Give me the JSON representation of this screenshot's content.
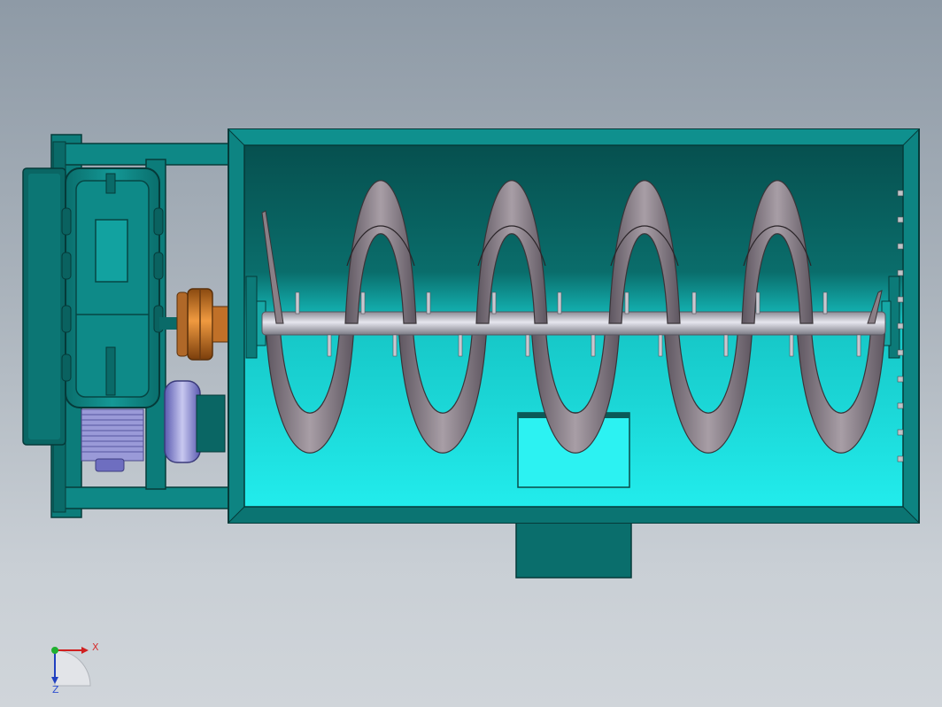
{
  "view": {
    "background_top": "#8e9aa6",
    "background_bottom": "#d0d5da"
  },
  "colors": {
    "frame_teal": "#0a7a78",
    "frame_dark": "#06504e",
    "trough_inner_top": "#075a58",
    "trough_inner_bottom": "#14e8e8",
    "shaft": "#b8b8c0",
    "flight": "#8a7f86",
    "coupling": "#d07a20",
    "motor_blue": "#7070c8"
  },
  "icons": {
    "triad": "coordinate-triad-icon"
  },
  "triad": {
    "x_label": "X",
    "z_label": "Z"
  }
}
